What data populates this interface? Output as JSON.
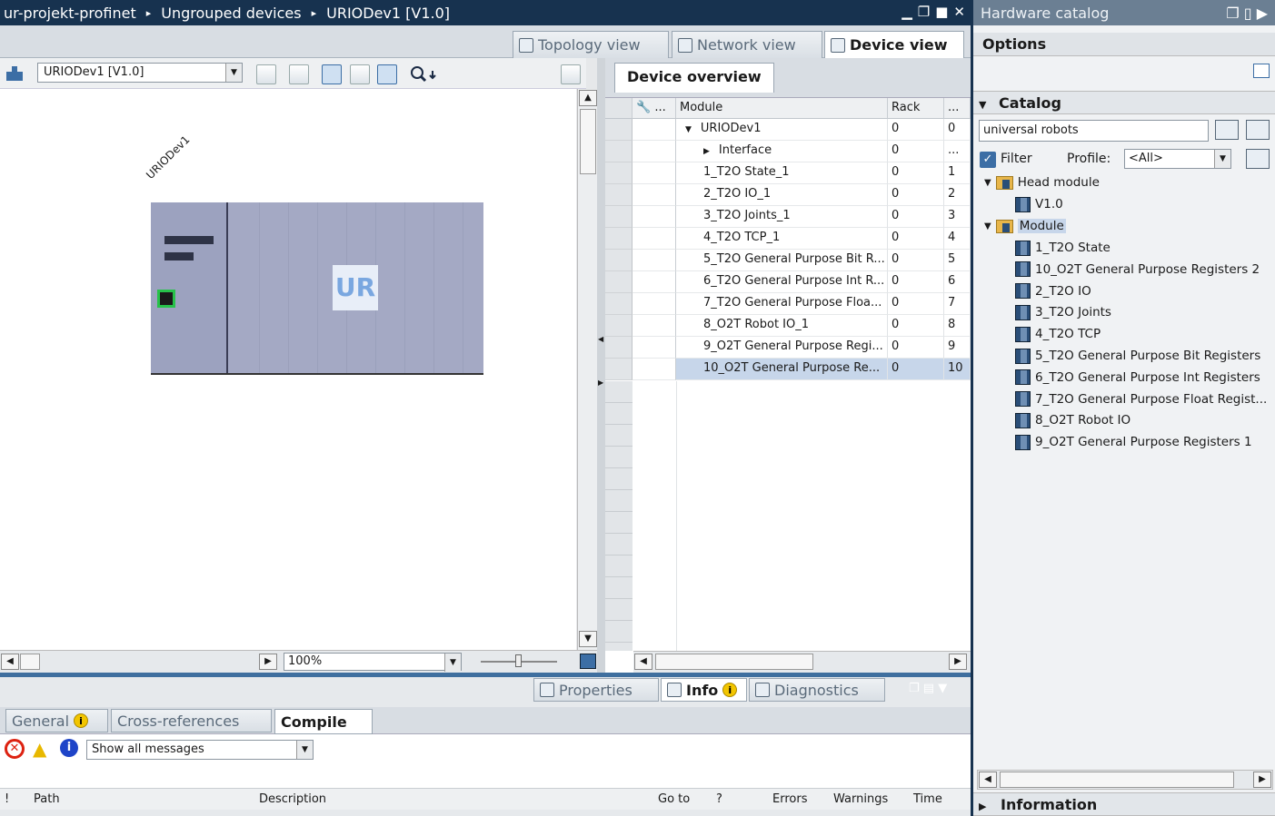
{
  "titlebar": {
    "crumb1": "ur-projekt-profinet",
    "crumb2": "Ungrouped devices",
    "crumb3": "URIODev1 [V1.0]",
    "separator": "▸"
  },
  "view_tabs": {
    "topology": "Topology view",
    "network": "Network view",
    "device": "Device view"
  },
  "toolbar": {
    "device_select": "URIODev1 [V1.0]"
  },
  "canvas": {
    "device_label": "URIODev1",
    "logo_text": "UR",
    "zoom": "100%"
  },
  "overview": {
    "tab": "Device overview",
    "columns": {
      "c1": "...",
      "module": "Module",
      "rack": "Rack",
      "slot": "..."
    },
    "rows": [
      {
        "module": "URIODev1",
        "rack": "0",
        "slot": "0"
      },
      {
        "module": "Interface",
        "rack": "0",
        "slot": "..."
      },
      {
        "module": "1_T2O State_1",
        "rack": "0",
        "slot": "1"
      },
      {
        "module": "2_T2O IO_1",
        "rack": "0",
        "slot": "2"
      },
      {
        "module": "3_T2O Joints_1",
        "rack": "0",
        "slot": "3"
      },
      {
        "module": "4_T2O TCP_1",
        "rack": "0",
        "slot": "4"
      },
      {
        "module": "5_T2O General Purpose Bit R...",
        "rack": "0",
        "slot": "5"
      },
      {
        "module": "6_T2O General Purpose Int R...",
        "rack": "0",
        "slot": "6"
      },
      {
        "module": "7_T2O General Purpose Floa...",
        "rack": "0",
        "slot": "7"
      },
      {
        "module": "8_O2T Robot IO_1",
        "rack": "0",
        "slot": "8"
      },
      {
        "module": "9_O2T General Purpose Regi...",
        "rack": "0",
        "slot": "9"
      },
      {
        "module": "10_O2T General Purpose Re...",
        "rack": "0",
        "slot": "10"
      }
    ]
  },
  "inspector_tabs": {
    "properties": "Properties",
    "info": "Info",
    "diagnostics": "Diagnostics",
    "info_badge": "i"
  },
  "bottom": {
    "tabs": {
      "general": "General",
      "xref": "Cross-references",
      "compile": "Compile"
    },
    "filter": "Show all messages",
    "columns": {
      "bang": "!",
      "path": "Path",
      "description": "Description",
      "goto": "Go to",
      "q": "?",
      "errors": "Errors",
      "warnings": "Warnings",
      "time": "Time"
    }
  },
  "catalog": {
    "title": "Hardware catalog",
    "options": "Options",
    "section": "Catalog",
    "search": "universal robots",
    "filter_label": "Filter",
    "profile_label": "Profile:",
    "profile_value": "<All>",
    "head_module": "Head module",
    "head_items": [
      "V1.0"
    ],
    "module_folder": "Module",
    "module_items": [
      "1_T2O State",
      "10_O2T General Purpose Registers 2",
      "2_T2O IO",
      "3_T2O Joints",
      "4_T2O TCP",
      "5_T2O General Purpose Bit Registers",
      "6_T2O General Purpose Int Registers",
      "7_T2O General Purpose Float Regist...",
      "8_O2T Robot IO",
      "9_O2T General Purpose Registers 1"
    ],
    "information": "Information"
  }
}
